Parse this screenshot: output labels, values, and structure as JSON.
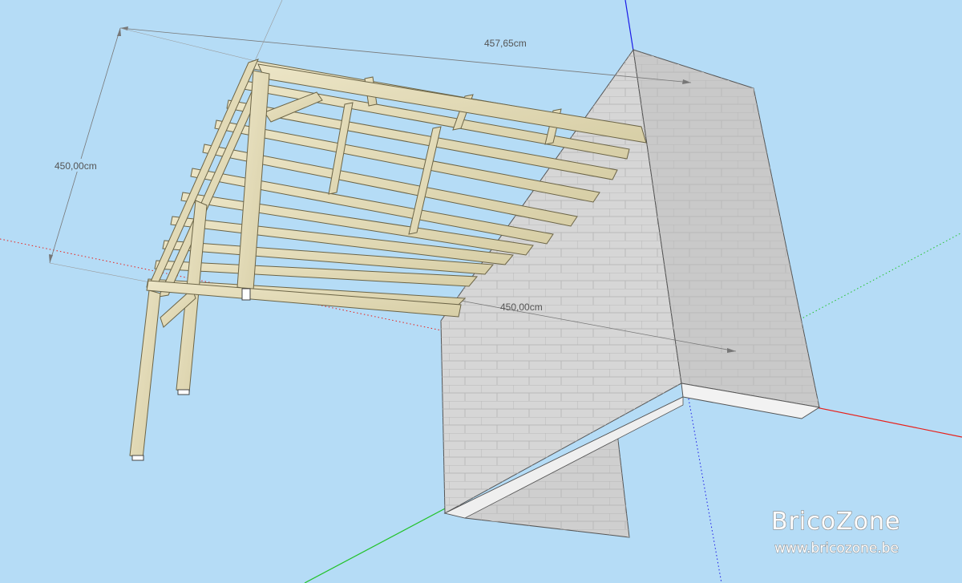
{
  "dimensions": {
    "width_top": "457,65cm",
    "height_left": "450,00cm",
    "depth_right": "450,00cm"
  },
  "watermark": {
    "brand": "BricoZone",
    "url": "www.bricozone.be"
  },
  "colors": {
    "sky": "#b5dcf6",
    "wood": "#e3dbb8",
    "wood_dark": "#c9bf95",
    "wall_front": "#d6d6d6",
    "wall_side": "#c4c4c4",
    "axis_red": "#e8201a",
    "axis_green": "#22c22a",
    "axis_blue": "#1a1ae8"
  }
}
